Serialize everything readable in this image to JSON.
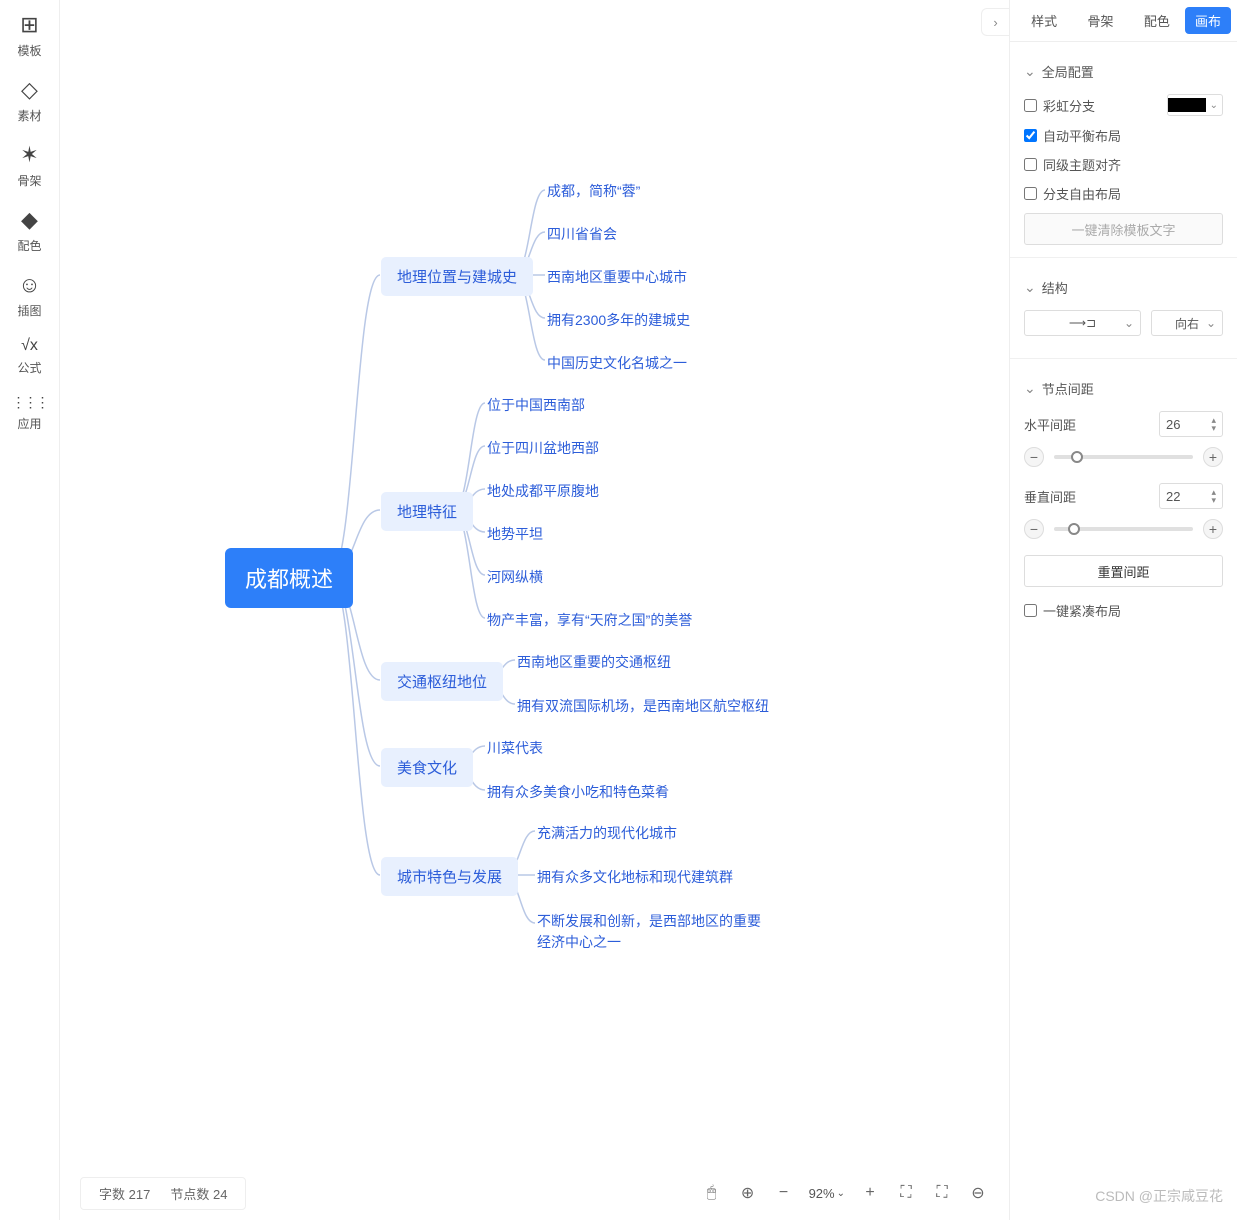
{
  "left_toolbar": [
    {
      "label": "模板",
      "icon": "⊞"
    },
    {
      "label": "素材",
      "icon": "◇"
    },
    {
      "label": "骨架",
      "icon": "✶"
    },
    {
      "label": "配色",
      "icon": "◆"
    },
    {
      "label": "插图",
      "icon": "☺"
    },
    {
      "label": "公式",
      "icon": "√x"
    },
    {
      "label": "应用",
      "icon": "⋮⋮⋮"
    }
  ],
  "tabs": [
    "样式",
    "骨架",
    "配色",
    "画布"
  ],
  "active_tab": "画布",
  "sections": {
    "global": {
      "title": "全局配置",
      "rainbow": "彩虹分支",
      "auto_balance": "自动平衡布局",
      "peer_align": "同级主题对齐",
      "free_branch": "分支自由布局",
      "clear_template": "一键清除模板文字"
    },
    "structure": {
      "title": "结构",
      "dir_icon": "⟶⊐",
      "dir_label": "向右"
    },
    "spacing": {
      "title": "节点间距",
      "h_label": "水平间距",
      "h_val": "26",
      "v_label": "垂直间距",
      "v_val": "22",
      "reset": "重置间距",
      "compact": "一键紧凑布局"
    }
  },
  "status": {
    "chars_label": "字数",
    "chars": "217",
    "nodes_label": "节点数",
    "nodes": "24",
    "zoom": "92%"
  },
  "watermark": "CSDN @正宗咸豆花",
  "mindmap": {
    "root": "成都概述",
    "branches": [
      {
        "label": "地理位置与建城史",
        "children": [
          "成都，简称“蓉”",
          "四川省省会",
          "西南地区重要中心城市",
          "拥有2300多年的建城史",
          "中国历史文化名城之一"
        ]
      },
      {
        "label": "地理特征",
        "children": [
          "位于中国西南部",
          "位于四川盆地西部",
          "地处成都平原腹地",
          "地势平坦",
          "河网纵横",
          "物产丰富，享有“天府之国”的美誉"
        ]
      },
      {
        "label": "交通枢纽地位",
        "children": [
          "西南地区重要的交通枢纽",
          "拥有双流国际机场，是西南地区航空枢纽"
        ]
      },
      {
        "label": "美食文化",
        "children": [
          "川菜代表",
          "拥有众多美食小吃和特色菜肴"
        ]
      },
      {
        "label": "城市特色与发展",
        "children": [
          "充满活力的现代化城市",
          "拥有众多文化地标和现代建筑群",
          "不断发展和创新，是西部地区的重要经济中心之一"
        ]
      }
    ]
  }
}
